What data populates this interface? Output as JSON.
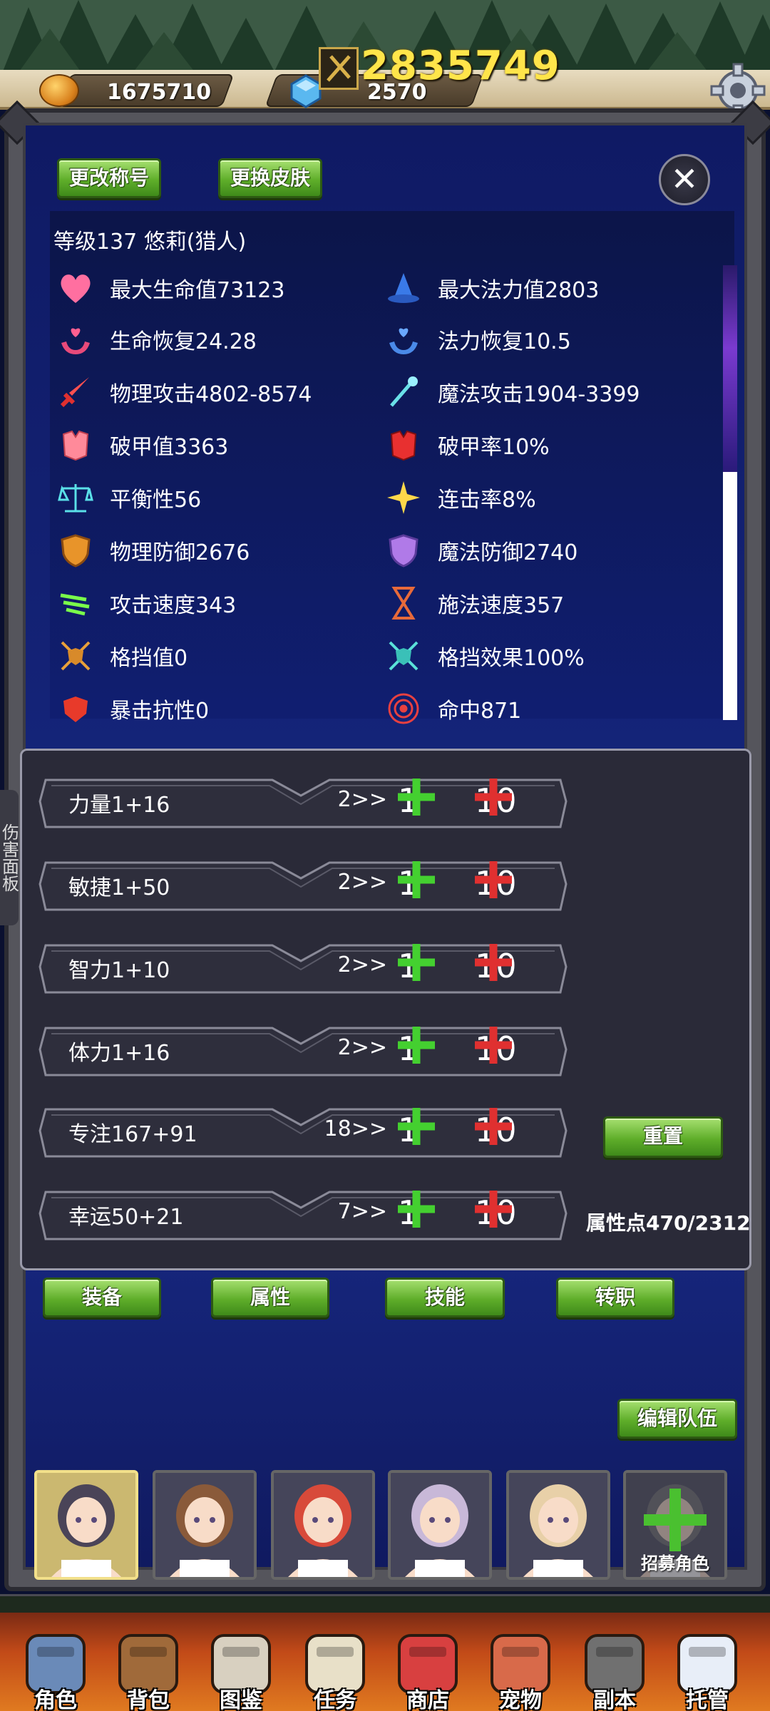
{
  "header": {
    "power": "2835749",
    "gold": "1675710",
    "gems": "2570"
  },
  "profile": {
    "change_title_button": "更改称号",
    "change_skin_button": "更换皮肤",
    "level_line": "等级137   悠莉(猎人)"
  },
  "stats": {
    "left": [
      "最大生命值73123",
      "生命恢复24.28",
      "物理攻击4802-8574",
      "破甲值3363",
      "平衡性56",
      "物理防御2676",
      "攻击速度343",
      "格挡值0",
      "暴击抗性0"
    ],
    "right": [
      "最大法力值2803",
      "法力恢复10.5",
      "魔法攻击1904-3399",
      "破甲率10%",
      "连击率8%",
      "魔法防御2740",
      "施法速度357",
      "格挡效果100%",
      "命中871"
    ]
  },
  "attributes": [
    {
      "name": "力量1+16",
      "cost": "2>>",
      "plus1": "1",
      "plus10": "10"
    },
    {
      "name": "敏捷1+50",
      "cost": "2>>",
      "plus1": "1",
      "plus10": "10"
    },
    {
      "name": "智力1+10",
      "cost": "2>>",
      "plus1": "1",
      "plus10": "10"
    },
    {
      "name": "体力1+16",
      "cost": "2>>",
      "plus1": "1",
      "plus10": "10"
    },
    {
      "name": "专注167+91",
      "cost": "18>>",
      "plus1": "1",
      "plus10": "10"
    },
    {
      "name": "幸运50+21",
      "cost": "7>>",
      "plus1": "1",
      "plus10": "10"
    }
  ],
  "reset_button": "重置",
  "attribute_points": "属性点470/2312",
  "side_tab": "伤害面板",
  "tabs": [
    "装备",
    "属性",
    "技能",
    "转职"
  ],
  "edit_team_button": "编辑队伍",
  "recruit_label": "招募角色",
  "nav": [
    "角色",
    "背包",
    "图鉴",
    "任务",
    "商店",
    "宠物",
    "副本",
    "托管"
  ],
  "colors": {
    "button_green": "#5fae2a",
    "plus_green": "#44d030",
    "plus_red": "#e03030",
    "power_yellow": "#ffe54a"
  }
}
